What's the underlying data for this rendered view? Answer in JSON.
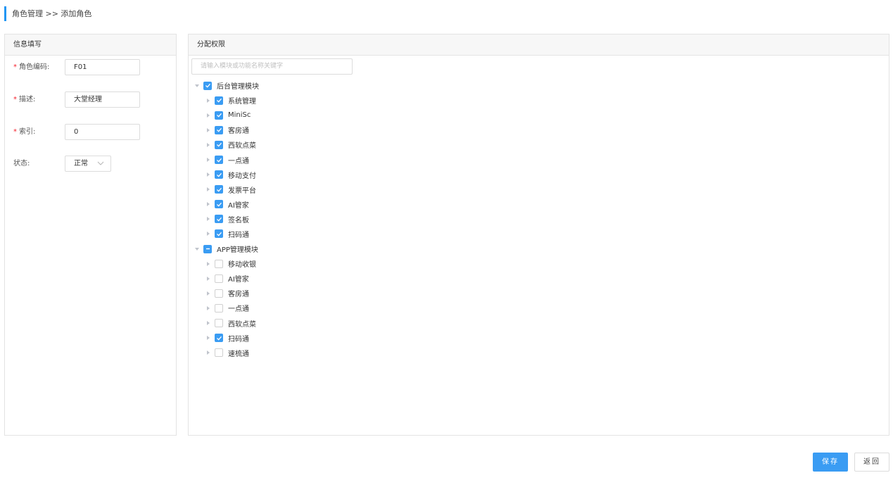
{
  "breadcrumb": {
    "text": "角色管理 >> 添加角色"
  },
  "left_panel": {
    "title": "信息填写",
    "fields": {
      "code": {
        "label": "角色编码:",
        "value": "F01",
        "required": true
      },
      "desc": {
        "label": "描述:",
        "value": "大堂经理",
        "required": true
      },
      "index": {
        "label": "索引:",
        "value": "0",
        "required": true
      },
      "status": {
        "label": "状态:",
        "value": "正常"
      }
    },
    "required_mark": "*"
  },
  "right_panel": {
    "title": "分配权限",
    "search_placeholder": "请输入模块或功能名称关键字",
    "tree": [
      {
        "label": "后台管理模块",
        "level": 0,
        "expanded": true,
        "state": "checked"
      },
      {
        "label": "系统管理",
        "level": 1,
        "state": "checked"
      },
      {
        "label": "MiniSc",
        "level": 1,
        "state": "checked"
      },
      {
        "label": "客房通",
        "level": 1,
        "state": "checked"
      },
      {
        "label": "西软点菜",
        "level": 1,
        "state": "checked"
      },
      {
        "label": "一点通",
        "level": 1,
        "state": "checked"
      },
      {
        "label": "移动支付",
        "level": 1,
        "state": "checked"
      },
      {
        "label": "发票平台",
        "level": 1,
        "state": "checked"
      },
      {
        "label": "AI管家",
        "level": 1,
        "state": "checked"
      },
      {
        "label": "签名板",
        "level": 1,
        "state": "checked"
      },
      {
        "label": "扫码通",
        "level": 1,
        "state": "checked"
      },
      {
        "label": "APP管理模块",
        "level": 0,
        "expanded": true,
        "state": "indeterminate"
      },
      {
        "label": "移动收银",
        "level": 1,
        "state": "unchecked"
      },
      {
        "label": "AI管家",
        "level": 1,
        "state": "unchecked"
      },
      {
        "label": "客房通",
        "level": 1,
        "state": "unchecked"
      },
      {
        "label": "一点通",
        "level": 1,
        "state": "unchecked"
      },
      {
        "label": "西软点菜",
        "level": 1,
        "state": "unchecked"
      },
      {
        "label": "扫码通",
        "level": 1,
        "state": "checked"
      },
      {
        "label": "速梳通",
        "level": 1,
        "state": "unchecked"
      }
    ]
  },
  "actions": {
    "save": "保存",
    "back": "返回"
  },
  "colors": {
    "accent": "#3a9cf3",
    "required": "#f5222d",
    "breadcrumb_bar": "#2196f3"
  }
}
